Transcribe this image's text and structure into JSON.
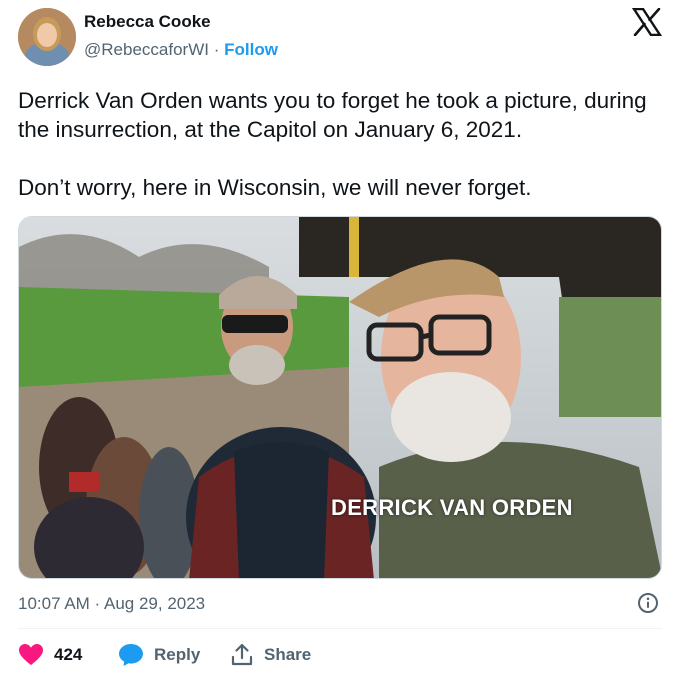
{
  "author": {
    "name": "Rebecca Cooke",
    "handle": "@RebeccaforWI",
    "separator": "·",
    "follow_label": "Follow",
    "avatar_icon": "profile-photo"
  },
  "tweet": {
    "paragraphs": [
      "Derrick Van Orden wants you to forget he took a picture, during the insurrection, at the Capitol on January 6, 2021.",
      "Don’t worry, here in Wisconsin, we will never forget."
    ],
    "media_caption": "DERRICK VAN ORDEN",
    "timestamp": "10:07 AM · Aug 29, 2023"
  },
  "actions": {
    "like_count": "424",
    "reply_label": "Reply",
    "share_label": "Share"
  },
  "colors": {
    "like": "#f91880",
    "reply": "#1d9bf0",
    "follow": "#1d9bf0",
    "text_secondary": "#536471"
  }
}
